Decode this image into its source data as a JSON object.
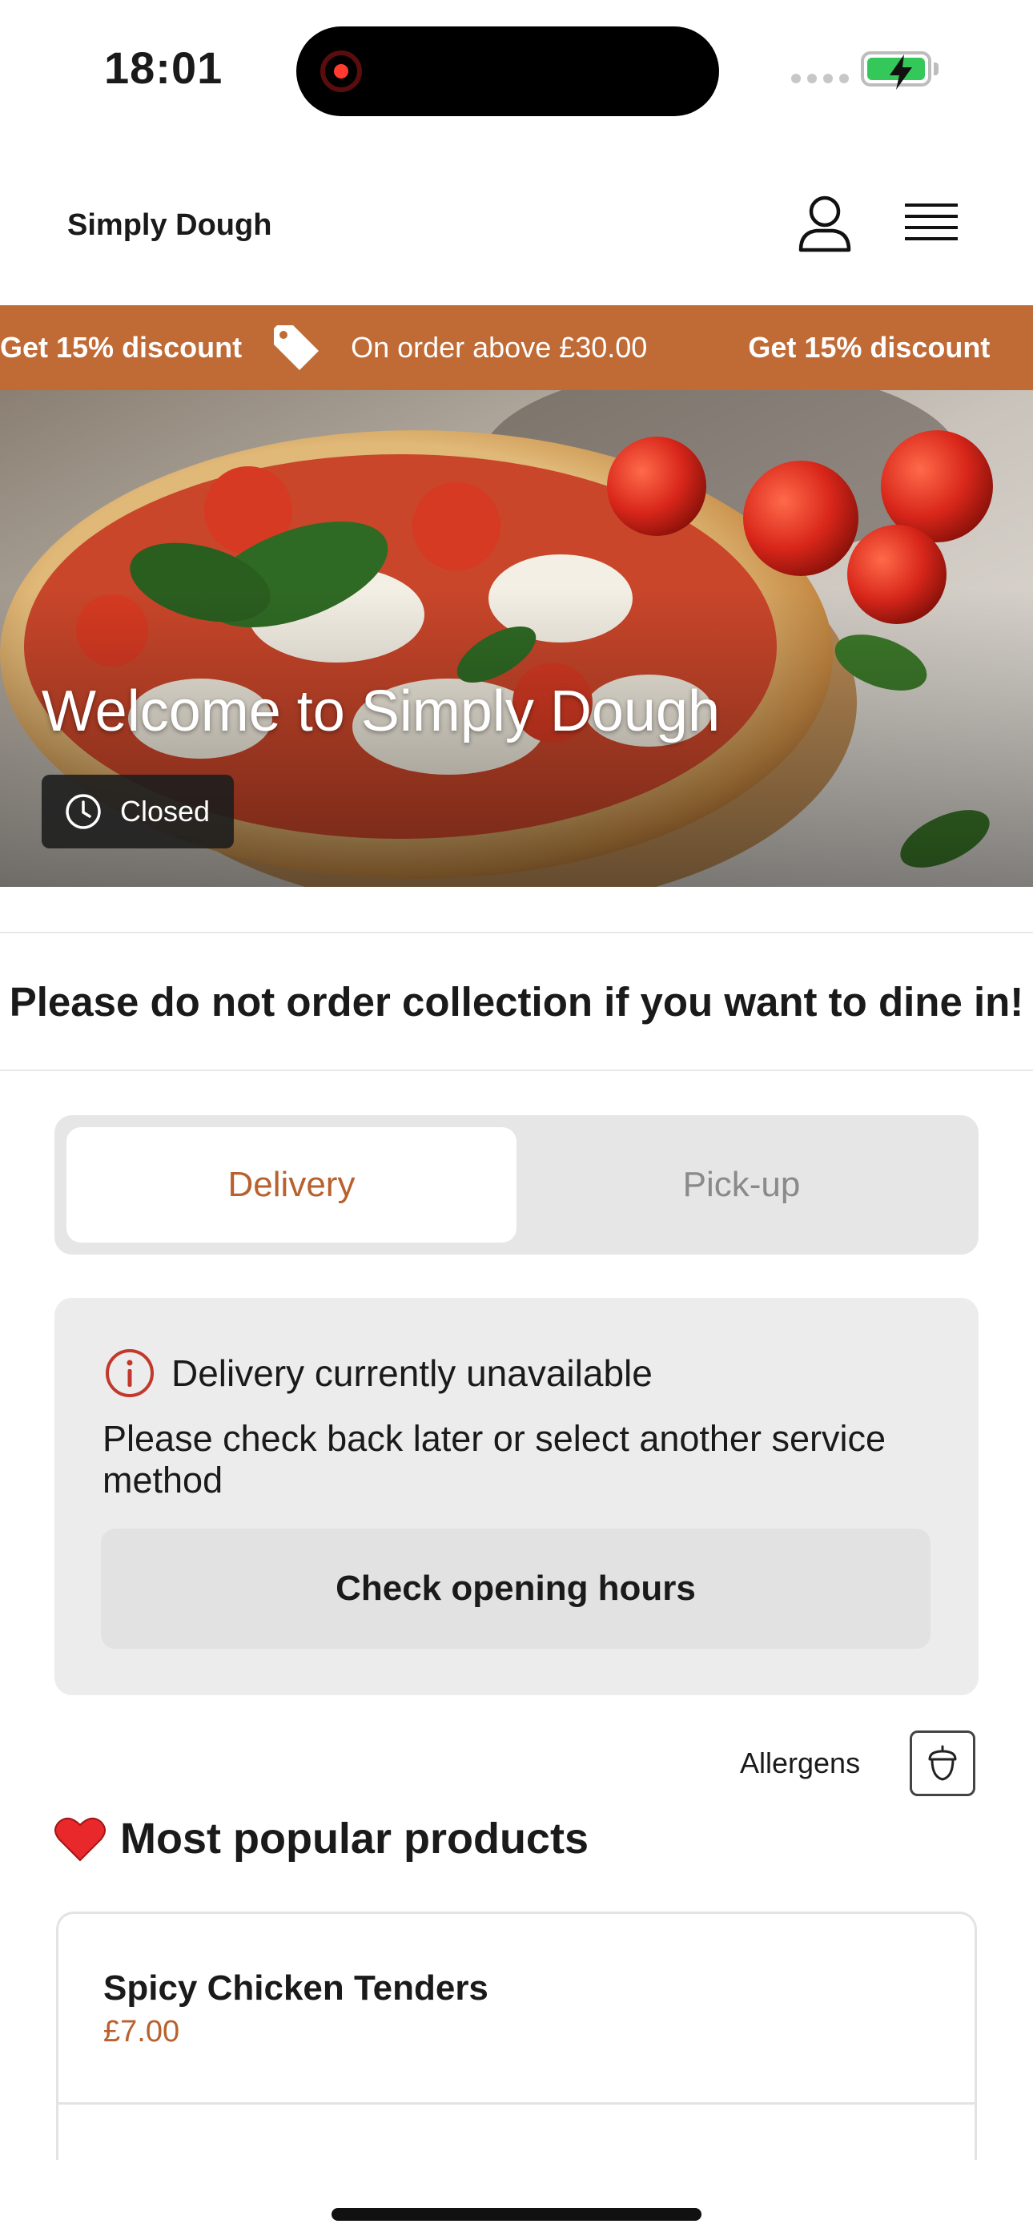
{
  "status_bar": {
    "time": "18:01"
  },
  "header": {
    "brand": "Simply Dough"
  },
  "promo": {
    "discount_text": "Get 15% discount",
    "condition_text": "On order above £30.00",
    "color": "#c06a35"
  },
  "hero": {
    "title": "Welcome to Simply Dough",
    "status": "Closed"
  },
  "notice": {
    "text": "Please do not order collection if you want to dine in!"
  },
  "service_toggle": {
    "tabs": [
      {
        "label": "Delivery",
        "selected": true
      },
      {
        "label": "Pick-up",
        "selected": false
      }
    ]
  },
  "availability": {
    "title": "Delivery currently unavailable",
    "message": "Please check back later or select another service method",
    "button_label": "Check opening hours"
  },
  "allergens": {
    "label": "Allergens"
  },
  "popular": {
    "title": "Most popular products",
    "products": [
      {
        "name": "Spicy Chicken Tenders",
        "price": "£7.00"
      }
    ]
  },
  "colors": {
    "accent": "#b8612f",
    "error": "#c0392b"
  }
}
